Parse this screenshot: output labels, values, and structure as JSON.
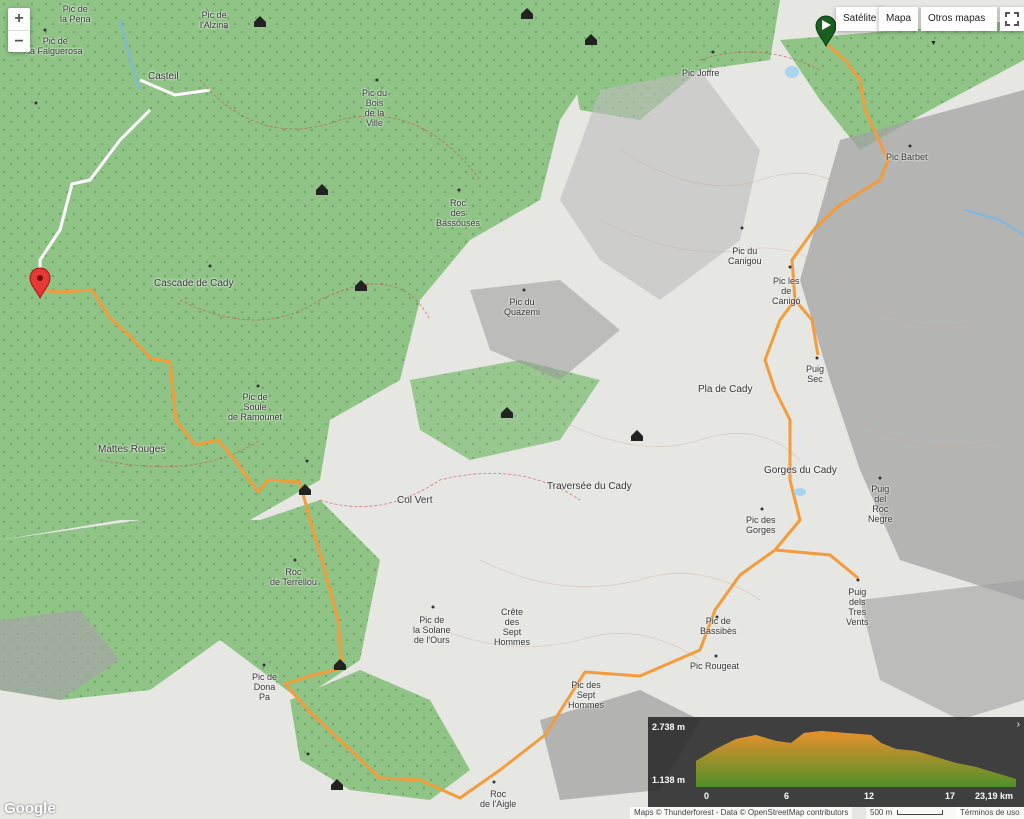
{
  "controls": {
    "zoom_in": "+",
    "zoom_out": "−",
    "satellite": "Satélite",
    "map": "Mapa",
    "other_maps": "Otros mapas"
  },
  "places": {
    "pic_de_la_pena": [
      "Pic de",
      "la Pena"
    ],
    "pic_de_la_falguerosa": [
      "Pic de",
      "la Falguerosa"
    ],
    "pic_de_lalzina": [
      "Pic de",
      "l'Alzina"
    ],
    "casteil": [
      "Casteil"
    ],
    "pic_joffre": [
      "Pic Joffre"
    ],
    "pic_du_bois_de_la_ville": [
      "Pic du",
      "Bois",
      "de la",
      "Ville"
    ],
    "pic_barbet": [
      "Pic Barbet"
    ],
    "roc_des_bassouses": [
      "Roc",
      "des",
      "Bassouses"
    ],
    "pic_du_canigou": [
      "Pic du",
      "Canigou"
    ],
    "pic_du_quazemi": [
      "Pic du",
      "Quazemi"
    ],
    "cascade_de_cady": [
      "Cascade de Cady"
    ],
    "pic_les_de_canigo": [
      "Pic les",
      "de",
      "Canigó"
    ],
    "puig_sec": [
      "Puig",
      "Sec"
    ],
    "pla_de_cady": [
      "Pla de Cady"
    ],
    "pic_de_soule_de_ramounet": [
      "Pic de",
      "Soule",
      "de Ramounet"
    ],
    "mattes_rouges": [
      "Mattes Rouges"
    ],
    "gorges_du_cady": [
      "Gorges du Cady"
    ],
    "traversee_du_cady": [
      "Traversée du Cady"
    ],
    "col_vert": [
      "Col Vert"
    ],
    "puig_del_roc_negre": [
      "Puig",
      "del",
      "Roc",
      "Negre"
    ],
    "pic_des_gorges": [
      "Pic des",
      "Gorges"
    ],
    "roc_de_terrellou": [
      "Roc",
      "de Terrellou"
    ],
    "puig_dels_tres_vents": [
      "Puig",
      "dels",
      "Tres",
      "Vents"
    ],
    "pic_de_la_solane_de_lours": [
      "Pic de",
      "la Solane",
      "de l'Ours"
    ],
    "crete_des_sept_hommes": [
      "Crête",
      "des",
      "Sept",
      "Hommes"
    ],
    "pic_de_bassibes": [
      "Pic de",
      "Bassibès"
    ],
    "pic_rougeat": [
      "Pic Rougeat"
    ],
    "pic_de_dona_pa": [
      "Pic de",
      "Dona",
      "Pa"
    ],
    "pic_des_sept_hommes": [
      "Pic des",
      "Sept",
      "Hommes"
    ],
    "roc_de_laigle": [
      "Roc",
      "de l'Aigle"
    ]
  },
  "elevation": {
    "max": "2.738 m",
    "min": "1.138 m",
    "ticks": [
      "0",
      "6",
      "12",
      "17",
      "23,19 km"
    ],
    "gradient_top": "#e8912c",
    "gradient_bottom": "#4f8f2a"
  },
  "footer": {
    "google": "Google",
    "attribution": "Maps © Thunderforest - Data © OpenStreetMap contributors",
    "scale": "500 m",
    "terms": "Términos de uso"
  },
  "colors": {
    "route": "#f39c3c",
    "forest": "#8fc486",
    "rock": "#9a9a9a",
    "start_marker": "#e53935",
    "end_flag": "#2e7d32"
  }
}
